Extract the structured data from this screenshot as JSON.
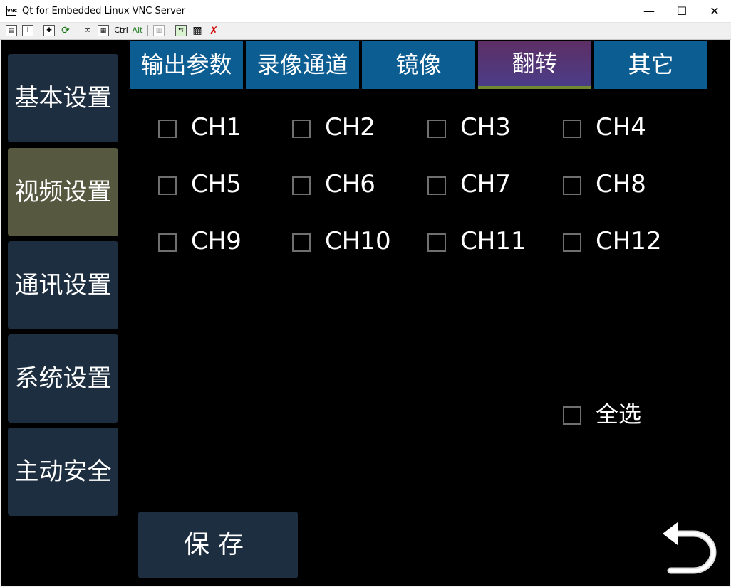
{
  "window": {
    "title": "Qt for Embedded Linux VNC Server",
    "icon_text": "VNC"
  },
  "toolbar": {
    "ctrl_label": "Ctrl",
    "alt_label": "Alt"
  },
  "sidebar": {
    "items": [
      {
        "label": "基本设置"
      },
      {
        "label": "视频设置",
        "active": true
      },
      {
        "label": "通讯设置"
      },
      {
        "label": "系统设置"
      },
      {
        "label": "主动安全"
      }
    ]
  },
  "tabs": [
    {
      "label": "输出参数"
    },
    {
      "label": "录像通道"
    },
    {
      "label": "镜像"
    },
    {
      "label": "翻转",
      "active": true
    },
    {
      "label": "其它"
    }
  ],
  "channels": [
    {
      "label": "CH1",
      "checked": false
    },
    {
      "label": "CH2",
      "checked": false
    },
    {
      "label": "CH3",
      "checked": false
    },
    {
      "label": "CH4",
      "checked": false
    },
    {
      "label": "CH5",
      "checked": false
    },
    {
      "label": "CH6",
      "checked": false
    },
    {
      "label": "CH7",
      "checked": false
    },
    {
      "label": "CH8",
      "checked": false
    },
    {
      "label": "CH9",
      "checked": false
    },
    {
      "label": "CH10",
      "checked": false
    },
    {
      "label": "CH11",
      "checked": false
    },
    {
      "label": "CH12",
      "checked": false
    }
  ],
  "select_all": {
    "label": "全选",
    "checked": false
  },
  "save_label": "保存",
  "colors": {
    "screen_bg": "#000000",
    "button_bg": "#1d2e40",
    "sidebar_active": "#56583f",
    "tab_bg": "#0c5d92",
    "tab_active_top": "#5d2f65",
    "tab_active_bottom": "#4b3d88",
    "tab_active_underline": "#6f8a32"
  }
}
